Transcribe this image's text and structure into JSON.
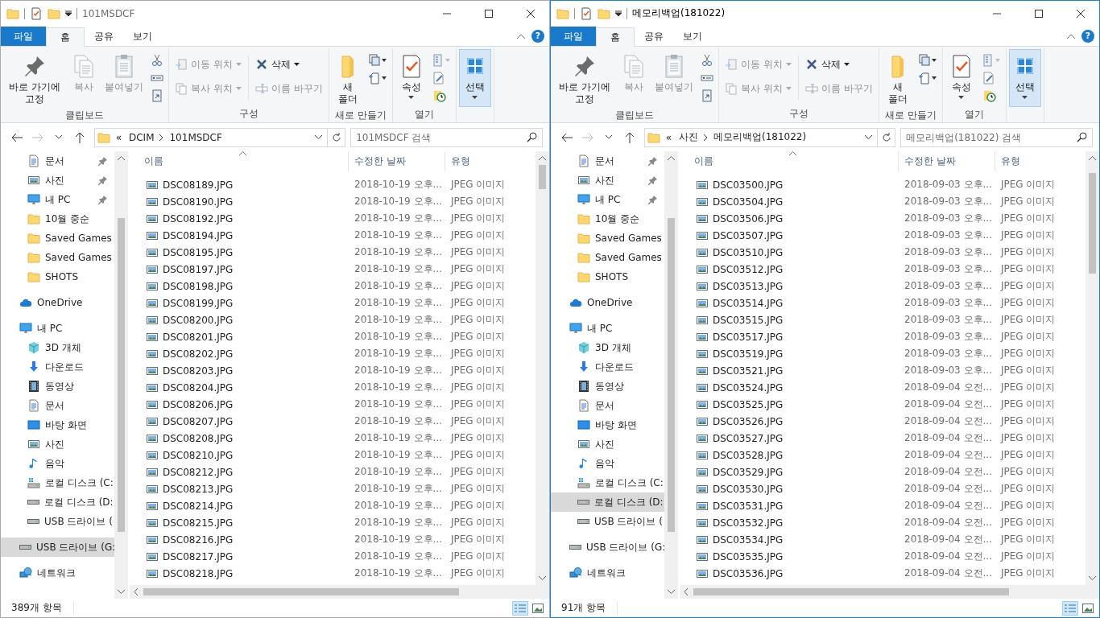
{
  "windows": [
    {
      "title": "101MSDCF",
      "active": false,
      "ribbon": {
        "tabs": [
          {
            "label": "파일",
            "kind": "file",
            "selected": false
          },
          {
            "label": "홈",
            "kind": "tab",
            "selected": true
          },
          {
            "label": "공유",
            "kind": "tab",
            "selected": false
          },
          {
            "label": "보기",
            "kind": "tab",
            "selected": false
          }
        ],
        "help_glyph": "?",
        "groups": [
          {
            "label": "클립보드",
            "commands": [
              {
                "kind": "large",
                "label": "바로 가기에 고정",
                "disabled": false,
                "dropdown": false,
                "highlighted": false
              },
              {
                "kind": "large",
                "label": "복사",
                "disabled": true,
                "dropdown": false,
                "highlighted": false
              },
              {
                "kind": "large",
                "label": "붙여넣기",
                "disabled": true,
                "dropdown": false,
                "highlighted": false
              }
            ]
          },
          {
            "label": "구성",
            "commands": [
              {
                "kind": "small",
                "label": "이동 위치",
                "disabled": true,
                "dropdown": true,
                "highlighted": false
              },
              {
                "kind": "small",
                "label": "복사 위치",
                "disabled": true,
                "dropdown": true,
                "highlighted": false
              },
              {
                "kind": "small",
                "label": "삭제",
                "disabled": false,
                "dropdown": true,
                "highlighted": false
              },
              {
                "kind": "small",
                "label": "이름 바꾸기",
                "disabled": true,
                "dropdown": false,
                "highlighted": false
              }
            ]
          },
          {
            "label": "새로 만들기",
            "commands": [
              {
                "kind": "large",
                "label": "새 폴더",
                "disabled": false,
                "dropdown": false,
                "highlighted": false
              }
            ]
          },
          {
            "label": "열기",
            "commands": [
              {
                "kind": "large",
                "label": "속성",
                "disabled": false,
                "dropdown": true,
                "highlighted": false
              }
            ]
          },
          {
            "commands": [
              {
                "kind": "large",
                "label": "선택",
                "disabled": false,
                "dropdown": true,
                "highlighted": true
              }
            ]
          }
        ]
      },
      "address": {
        "overflow_mark": "«",
        "crumbs": [
          "DCIM",
          "101MSDCF"
        ]
      },
      "search": {
        "placeholder": "101MSDCF 검색"
      },
      "nav": {
        "quick_access": [
          {
            "label": "문서",
            "kind": "docs",
            "pinned": true,
            "selected": false
          },
          {
            "label": "사진",
            "kind": "pictures",
            "pinned": true,
            "selected": false
          },
          {
            "label": "내 PC",
            "kind": "pc",
            "pinned": true,
            "selected": false
          },
          {
            "label": "10월 중순",
            "kind": "folder",
            "pinned": false,
            "selected": false
          },
          {
            "label": "Saved Games",
            "kind": "folder",
            "pinned": false,
            "selected": false
          },
          {
            "label": "Saved Games",
            "kind": "folder",
            "pinned": false,
            "selected": false
          },
          {
            "label": "SHOTS",
            "kind": "folder",
            "pinned": false,
            "selected": false
          }
        ],
        "items": [
          {
            "label": "OneDrive",
            "kind": "onedrive",
            "selected": false
          },
          {
            "label": "내 PC",
            "kind": "pc",
            "selected": false,
            "children": [
              {
                "label": "3D 개체",
                "kind": "objects3d",
                "selected": false
              },
              {
                "label": "다운로드",
                "kind": "downloads",
                "selected": false
              },
              {
                "label": "동영상",
                "kind": "videos",
                "selected": false
              },
              {
                "label": "문서",
                "kind": "docs",
                "selected": false
              },
              {
                "label": "바탕 화면",
                "kind": "desktop",
                "selected": false
              },
              {
                "label": "사진",
                "kind": "pictures",
                "selected": false
              },
              {
                "label": "음악",
                "kind": "music",
                "selected": false
              },
              {
                "label": "로컬 디스크 (C:",
                "kind": "system_drive",
                "selected": false
              },
              {
                "label": "로컬 디스크 (D:",
                "kind": "drive",
                "selected": false
              },
              {
                "label": "USB 드라이브 (",
                "kind": "drive",
                "selected": false
              }
            ]
          },
          {
            "label": "USB 드라이브 (G:",
            "kind": "drive",
            "selected": true
          },
          {
            "label": "네트워크",
            "kind": "network",
            "selected": false
          }
        ]
      },
      "columns": [
        "이름",
        "수정한 날짜",
        "유형"
      ],
      "rows": [
        {
          "name": "DSC08189.JPG",
          "date": "2018-10-19 오후...",
          "type": "JPEG 이미지"
        },
        {
          "name": "DSC08190.JPG",
          "date": "2018-10-19 오후...",
          "type": "JPEG 이미지"
        },
        {
          "name": "DSC08192.JPG",
          "date": "2018-10-19 오후...",
          "type": "JPEG 이미지"
        },
        {
          "name": "DSC08194.JPG",
          "date": "2018-10-19 오후...",
          "type": "JPEG 이미지"
        },
        {
          "name": "DSC08195.JPG",
          "date": "2018-10-19 오후...",
          "type": "JPEG 이미지"
        },
        {
          "name": "DSC08197.JPG",
          "date": "2018-10-19 오후...",
          "type": "JPEG 이미지"
        },
        {
          "name": "DSC08198.JPG",
          "date": "2018-10-19 오후...",
          "type": "JPEG 이미지"
        },
        {
          "name": "DSC08199.JPG",
          "date": "2018-10-19 오후...",
          "type": "JPEG 이미지"
        },
        {
          "name": "DSC08200.JPG",
          "date": "2018-10-19 오후...",
          "type": "JPEG 이미지"
        },
        {
          "name": "DSC08201.JPG",
          "date": "2018-10-19 오후...",
          "type": "JPEG 이미지"
        },
        {
          "name": "DSC08202.JPG",
          "date": "2018-10-19 오후...",
          "type": "JPEG 이미지"
        },
        {
          "name": "DSC08203.JPG",
          "date": "2018-10-19 오후...",
          "type": "JPEG 이미지"
        },
        {
          "name": "DSC08204.JPG",
          "date": "2018-10-19 오후...",
          "type": "JPEG 이미지"
        },
        {
          "name": "DSC08206.JPG",
          "date": "2018-10-19 오후...",
          "type": "JPEG 이미지"
        },
        {
          "name": "DSC08207.JPG",
          "date": "2018-10-19 오후...",
          "type": "JPEG 이미지"
        },
        {
          "name": "DSC08208.JPG",
          "date": "2018-10-19 오후...",
          "type": "JPEG 이미지"
        },
        {
          "name": "DSC08210.JPG",
          "date": "2018-10-19 오후...",
          "type": "JPEG 이미지"
        },
        {
          "name": "DSC08212.JPG",
          "date": "2018-10-19 오후...",
          "type": "JPEG 이미지"
        },
        {
          "name": "DSC08213.JPG",
          "date": "2018-10-19 오후...",
          "type": "JPEG 이미지"
        },
        {
          "name": "DSC08214.JPG",
          "date": "2018-10-19 오후...",
          "type": "JPEG 이미지"
        },
        {
          "name": "DSC08215.JPG",
          "date": "2018-10-19 오후...",
          "type": "JPEG 이미지"
        },
        {
          "name": "DSC08216.JPG",
          "date": "2018-10-19 오후...",
          "type": "JPEG 이미지"
        },
        {
          "name": "DSC08217.JPG",
          "date": "2018-10-19 오후...",
          "type": "JPEG 이미지"
        },
        {
          "name": "DSC08218.JPG",
          "date": "2018-10-19 오후...",
          "type": "JPEG 이미지"
        }
      ],
      "status": "389개 항목",
      "views": [
        {
          "selected": true
        },
        {
          "selected": false
        }
      ]
    },
    {
      "title": "메모리백업(181022)",
      "active": true,
      "ribbon": {
        "tabs": [
          {
            "label": "파일",
            "kind": "file",
            "selected": false
          },
          {
            "label": "홈",
            "kind": "tab",
            "selected": true
          },
          {
            "label": "공유",
            "kind": "tab",
            "selected": false
          },
          {
            "label": "보기",
            "kind": "tab",
            "selected": false
          }
        ],
        "help_glyph": "?",
        "groups": [
          {
            "label": "클립보드",
            "commands": [
              {
                "kind": "large",
                "label": "바로 가기에 고정",
                "disabled": false,
                "dropdown": false,
                "highlighted": false
              },
              {
                "kind": "large",
                "label": "복사",
                "disabled": true,
                "dropdown": false,
                "highlighted": false
              },
              {
                "kind": "large",
                "label": "붙여넣기",
                "disabled": true,
                "dropdown": false,
                "highlighted": false
              }
            ]
          },
          {
            "label": "구성",
            "commands": [
              {
                "kind": "small",
                "label": "이동 위치",
                "disabled": true,
                "dropdown": true,
                "highlighted": false
              },
              {
                "kind": "small",
                "label": "복사 위치",
                "disabled": true,
                "dropdown": true,
                "highlighted": false
              },
              {
                "kind": "small",
                "label": "삭제",
                "disabled": false,
                "dropdown": true,
                "highlighted": false
              },
              {
                "kind": "small",
                "label": "이름 바꾸기",
                "disabled": true,
                "dropdown": false,
                "highlighted": false
              }
            ]
          },
          {
            "label": "새로 만들기",
            "commands": [
              {
                "kind": "large",
                "label": "새 폴더",
                "disabled": false,
                "dropdown": false,
                "highlighted": false
              }
            ]
          },
          {
            "label": "열기",
            "commands": [
              {
                "kind": "large",
                "label": "속성",
                "disabled": false,
                "dropdown": true,
                "highlighted": false
              }
            ]
          },
          {
            "commands": [
              {
                "kind": "large",
                "label": "선택",
                "disabled": false,
                "dropdown": true,
                "highlighted": true
              }
            ]
          }
        ]
      },
      "address": {
        "overflow_mark": "«",
        "crumbs": [
          "사진",
          "메모리백업(181022)"
        ]
      },
      "search": {
        "placeholder": "메모리백업(181022) 검색"
      },
      "nav": {
        "quick_access": [
          {
            "label": "문서",
            "kind": "docs",
            "pinned": true,
            "selected": false
          },
          {
            "label": "사진",
            "kind": "pictures",
            "pinned": true,
            "selected": false
          },
          {
            "label": "내 PC",
            "kind": "pc",
            "pinned": true,
            "selected": false
          },
          {
            "label": "10월 중순",
            "kind": "folder",
            "pinned": false,
            "selected": false
          },
          {
            "label": "Saved Games",
            "kind": "folder",
            "pinned": false,
            "selected": false
          },
          {
            "label": "Saved Games",
            "kind": "folder",
            "pinned": false,
            "selected": false
          },
          {
            "label": "SHOTS",
            "kind": "folder",
            "pinned": false,
            "selected": false
          }
        ],
        "items": [
          {
            "label": "OneDrive",
            "kind": "onedrive",
            "selected": false
          },
          {
            "label": "내 PC",
            "kind": "pc",
            "selected": false,
            "children": [
              {
                "label": "3D 개체",
                "kind": "objects3d",
                "selected": false
              },
              {
                "label": "다운로드",
                "kind": "downloads",
                "selected": false
              },
              {
                "label": "동영상",
                "kind": "videos",
                "selected": false
              },
              {
                "label": "문서",
                "kind": "docs",
                "selected": false
              },
              {
                "label": "바탕 화면",
                "kind": "desktop",
                "selected": false
              },
              {
                "label": "사진",
                "kind": "pictures",
                "selected": false
              },
              {
                "label": "음악",
                "kind": "music",
                "selected": false
              },
              {
                "label": "로컬 디스크 (C:",
                "kind": "system_drive",
                "selected": false
              },
              {
                "label": "로컬 디스크 (D:",
                "kind": "drive",
                "selected": true
              },
              {
                "label": "USB 드라이브 (",
                "kind": "drive",
                "selected": false
              }
            ]
          },
          {
            "label": "USB 드라이브 (G:",
            "kind": "drive",
            "selected": false
          },
          {
            "label": "네트워크",
            "kind": "network",
            "selected": false
          }
        ]
      },
      "columns": [
        "이름",
        "수정한 날짜",
        "유형"
      ],
      "rows": [
        {
          "name": "DSC03500.JPG",
          "date": "2018-09-03 오후...",
          "type": "JPEG 이미지"
        },
        {
          "name": "DSC03504.JPG",
          "date": "2018-09-03 오후...",
          "type": "JPEG 이미지"
        },
        {
          "name": "DSC03506.JPG",
          "date": "2018-09-03 오후...",
          "type": "JPEG 이미지"
        },
        {
          "name": "DSC03507.JPG",
          "date": "2018-09-03 오후...",
          "type": "JPEG 이미지"
        },
        {
          "name": "DSC03510.JPG",
          "date": "2018-09-03 오후...",
          "type": "JPEG 이미지"
        },
        {
          "name": "DSC03512.JPG",
          "date": "2018-09-03 오후...",
          "type": "JPEG 이미지"
        },
        {
          "name": "DSC03513.JPG",
          "date": "2018-09-03 오후...",
          "type": "JPEG 이미지"
        },
        {
          "name": "DSC03514.JPG",
          "date": "2018-09-03 오후...",
          "type": "JPEG 이미지"
        },
        {
          "name": "DSC03515.JPG",
          "date": "2018-09-03 오후...",
          "type": "JPEG 이미지"
        },
        {
          "name": "DSC03517.JPG",
          "date": "2018-09-03 오후...",
          "type": "JPEG 이미지"
        },
        {
          "name": "DSC03519.JPG",
          "date": "2018-09-03 오후...",
          "type": "JPEG 이미지"
        },
        {
          "name": "DSC03521.JPG",
          "date": "2018-09-03 오후...",
          "type": "JPEG 이미지"
        },
        {
          "name": "DSC03524.JPG",
          "date": "2018-09-04 오전...",
          "type": "JPEG 이미지"
        },
        {
          "name": "DSC03525.JPG",
          "date": "2018-09-04 오전...",
          "type": "JPEG 이미지"
        },
        {
          "name": "DSC03526.JPG",
          "date": "2018-09-04 오전...",
          "type": "JPEG 이미지"
        },
        {
          "name": "DSC03527.JPG",
          "date": "2018-09-04 오전...",
          "type": "JPEG 이미지"
        },
        {
          "name": "DSC03528.JPG",
          "date": "2018-09-04 오전...",
          "type": "JPEG 이미지"
        },
        {
          "name": "DSC03529.JPG",
          "date": "2018-09-04 오전...",
          "type": "JPEG 이미지"
        },
        {
          "name": "DSC03530.JPG",
          "date": "2018-09-04 오전...",
          "type": "JPEG 이미지"
        },
        {
          "name": "DSC03531.JPG",
          "date": "2018-09-04 오전...",
          "type": "JPEG 이미지"
        },
        {
          "name": "DSC03532.JPG",
          "date": "2018-09-04 오전...",
          "type": "JPEG 이미지"
        },
        {
          "name": "DSC03534.JPG",
          "date": "2018-09-04 오전...",
          "type": "JPEG 이미지"
        },
        {
          "name": "DSC03535.JPG",
          "date": "2018-09-04 오전...",
          "type": "JPEG 이미지"
        },
        {
          "name": "DSC03536.JPG",
          "date": "2018-09-04 오전...",
          "type": "JPEG 이미지"
        }
      ],
      "status": "91개 항목",
      "views": [
        {
          "selected": true
        },
        {
          "selected": false
        }
      ]
    }
  ]
}
